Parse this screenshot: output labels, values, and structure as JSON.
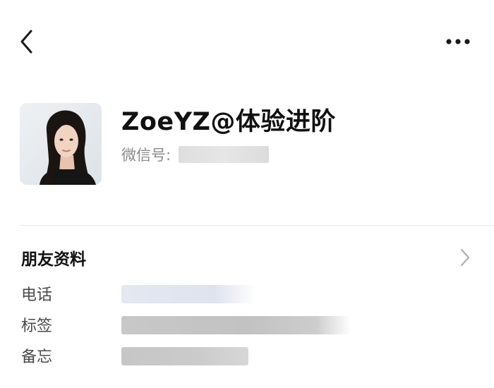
{
  "header": {
    "back_icon": "chevron-left-icon",
    "more_icon": "more-horizontal-icon"
  },
  "profile": {
    "name": "ZoeYZ@体验进阶",
    "wechat_id_label": "微信号:",
    "avatar_icon": "contact-avatar"
  },
  "friend_info": {
    "title": "朋友资料",
    "chevron_icon": "chevron-right-icon",
    "fields": [
      {
        "label": "电话"
      },
      {
        "label": "标签"
      },
      {
        "label": "备忘"
      }
    ]
  },
  "colors": {
    "background": "#ffffff",
    "primary_text": "#111111",
    "secondary_text": "#8a8a8a",
    "divider": "#e8e8e8"
  }
}
